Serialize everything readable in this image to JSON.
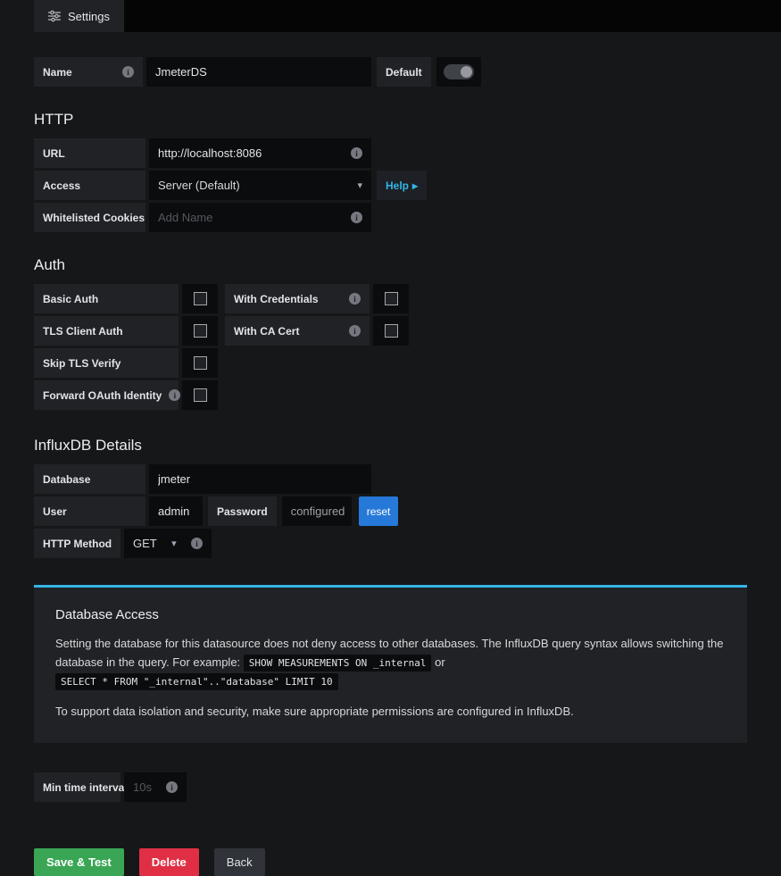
{
  "colors": {
    "page_bg": "#161719",
    "label_bg": "#202226",
    "input_bg": "#0b0c0e",
    "accent_blue": "#33b5e5",
    "reset_blue": "#2679d8",
    "success_green": "#3aa655",
    "danger_red": "#e02f44"
  },
  "header": {
    "tab_settings": "Settings"
  },
  "basic": {
    "name_label": "Name",
    "name_value": "JmeterDS",
    "default_label": "Default"
  },
  "http": {
    "title": "HTTP",
    "url_label": "URL",
    "url_value": "http://localhost:8086",
    "access_label": "Access",
    "access_value": "Server (Default)",
    "access_caret": "▾",
    "help_label": "Help",
    "help_chevron": "▸",
    "cookies_label": "Whitelisted Cookies",
    "cookies_placeholder": "Add Name"
  },
  "auth": {
    "title": "Auth",
    "left_rows": [
      {
        "label": "Basic Auth"
      },
      {
        "label": "TLS Client Auth"
      },
      {
        "label": "Skip TLS Verify"
      },
      {
        "label": "Forward OAuth Identity"
      }
    ],
    "right_rows": [
      {
        "label": "With Credentials"
      },
      {
        "label": "With CA Cert"
      }
    ]
  },
  "influx": {
    "title": "InfluxDB Details",
    "database_label": "Database",
    "database_value": "jmeter",
    "user_label": "User",
    "user_value": "admin",
    "password_label": "Password",
    "password_status": "configured",
    "reset_label": "reset",
    "method_label": "HTTP Method",
    "method_value": "GET",
    "method_caret": "▾"
  },
  "info_box": {
    "title": "Database Access",
    "p1_a": "Setting the database for this datasource does not deny access to other databases. The InfluxDB query syntax allows switching the database in the query. For example:",
    "code1": "SHOW MEASUREMENTS ON _internal",
    "p1_b": "or",
    "code2": "SELECT * FROM \"_internal\"..\"database\" LIMIT 10",
    "p2": "To support data isolation and security, make sure appropriate permissions are configured in InfluxDB."
  },
  "min_interval": {
    "label": "Min time interval",
    "placeholder": "10s"
  },
  "buttons": {
    "save": "Save & Test",
    "delete": "Delete",
    "back": "Back"
  }
}
